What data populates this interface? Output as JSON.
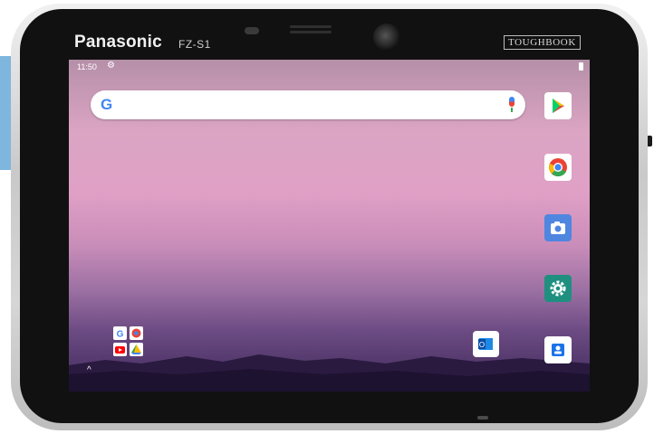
{
  "device": {
    "brand": "Panasonic",
    "model": "FZ-S1",
    "series_badge": "TOUGHBOOK"
  },
  "statusbar": {
    "time": "11:50",
    "icons": [
      "settings-gear-icon",
      "battery-icon"
    ]
  },
  "home": {
    "search_bar": {
      "logo": "G",
      "icons": [
        "google-g-icon",
        "microphone-icon"
      ]
    },
    "dock_apps": [
      {
        "icon": "play-store-icon"
      },
      {
        "icon": "chrome-icon"
      },
      {
        "icon": "camera-icon"
      },
      {
        "icon": "settings-icon"
      },
      {
        "icon": "contacts-icon"
      }
    ],
    "desktop_apps": [
      {
        "icon": "google-apps-folder-icon"
      },
      {
        "icon": "outlook-icon"
      }
    ],
    "app_drawer_hint": "^"
  },
  "colors": {
    "google_blue": "#4285f4",
    "google_red": "#ea4335",
    "google_yellow": "#fbbc05",
    "google_green": "#34a853",
    "camera_blue": "#4e86e0",
    "settings_teal": "#1f8f80"
  }
}
